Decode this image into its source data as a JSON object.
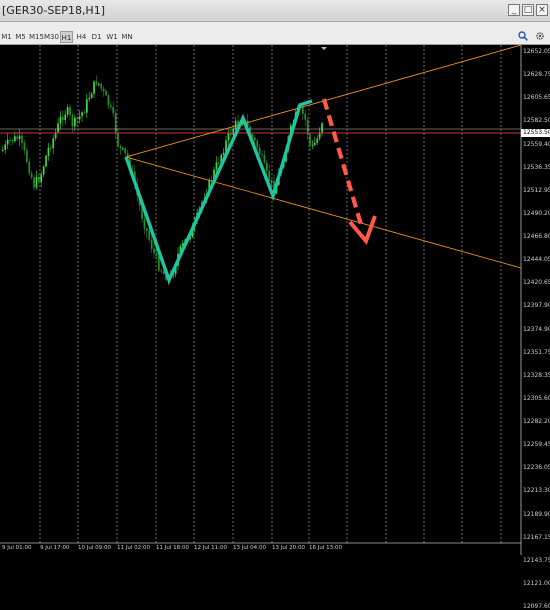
{
  "window": {
    "title": "[GER30-SEP18,H1]"
  },
  "timeframes": [
    "M1",
    "M5",
    "M15",
    "M30",
    "H1",
    "H4",
    "D1",
    "W1",
    "MN"
  ],
  "active_timeframe": "H1",
  "price_axis": [
    "12652.05",
    "12628.75",
    "12605.65",
    "12582.50",
    "12559.40",
    "12536.35",
    "12512.95",
    "12490.20",
    "12466.80",
    "12444.05",
    "12420.65",
    "12397.90",
    "12374.90",
    "12351.75",
    "12328.35",
    "12305.60",
    "12282.20",
    "12259.45",
    "12236.05",
    "12213.30",
    "12189.90",
    "12167.15",
    "12143.75",
    "12121.00",
    "12097.60"
  ],
  "current_price": "12553.50",
  "time_axis": [
    "9 Jul 01:00",
    "9 Jul 17:00",
    "10 Jul 09:00",
    "11 Jul 02:00",
    "11 Jul 18:00",
    "12 Jul 11:00",
    "13 Jul 04:00",
    "13 Jul 20:00",
    "16 Jul 13:00"
  ],
  "colors": {
    "background": "#000000",
    "candle_up": "#3fdc3f",
    "candle_down": "#2a8f2a",
    "channel": "#ff9c1a",
    "pattern": "#1ec5a3",
    "forecast_arrow": "#ff5a44",
    "price_line": "#d23030",
    "grid": "#9a9a9a"
  },
  "icons": {
    "search": "search-icon",
    "settings": "gear-icon"
  }
}
